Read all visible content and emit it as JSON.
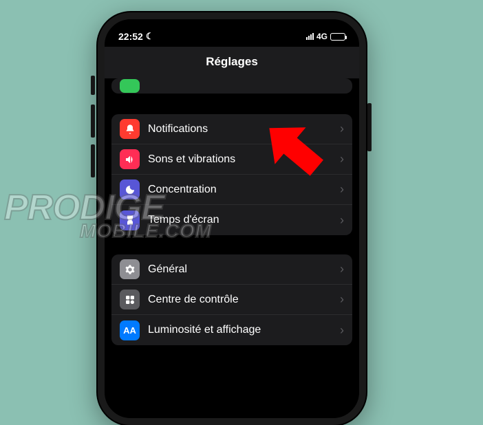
{
  "status": {
    "time": "22:52",
    "dnd_glyph": "☾",
    "network_label": "4G"
  },
  "header": {
    "title": "Réglages"
  },
  "group_stub": {
    "label": ""
  },
  "group1": {
    "items": [
      {
        "label": "Notifications"
      },
      {
        "label": "Sons et vibrations"
      },
      {
        "label": "Concentration"
      },
      {
        "label": "Temps d'écran"
      }
    ]
  },
  "group2": {
    "items": [
      {
        "label": "Général"
      },
      {
        "label": "Centre de contrôle"
      },
      {
        "label": "Luminosité et affichage"
      }
    ]
  },
  "watermark": {
    "line1": "PRODIGE",
    "line2": "MOBILE.COM"
  },
  "icons": {
    "aa_text": "AA"
  }
}
